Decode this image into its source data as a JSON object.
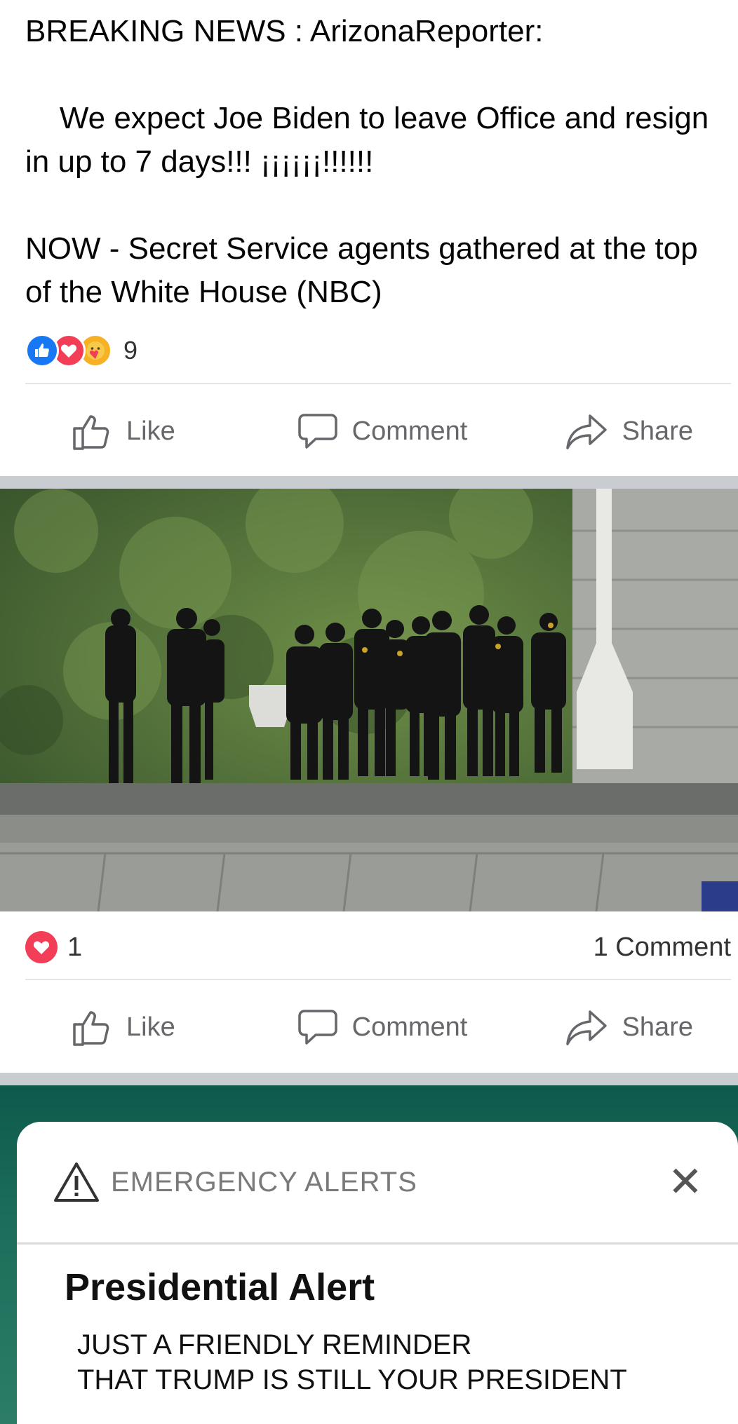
{
  "post": {
    "line1": "BREAKING NEWS : ArizonaReporter:",
    "line2": "    We expect Joe Biden to leave Office and resign in up to 7 days!!! ¡¡¡¡¡¡!!!!!!",
    "line3": "NOW - Secret Service agents gathered at the top of the White House (NBC)",
    "reaction_count": "9",
    "reactions": [
      "like",
      "love",
      "care"
    ]
  },
  "actions": {
    "like": "Like",
    "comment": "Comment",
    "share": "Share"
  },
  "photo_post": {
    "love_count": "1",
    "comment_count": "1 Comment"
  },
  "alert": {
    "header": "EMERGENCY ALERTS",
    "title": "Presidential Alert",
    "message_line1": "JUST A FRIENDLY REMINDER",
    "message_line2": "THAT TRUMP IS STILL YOUR PRESIDENT"
  },
  "colors": {
    "facebook_blue": "#1877f2",
    "love_red": "#f33e58",
    "action_gray": "#65676b",
    "separator_gray": "#c9ccd1"
  }
}
